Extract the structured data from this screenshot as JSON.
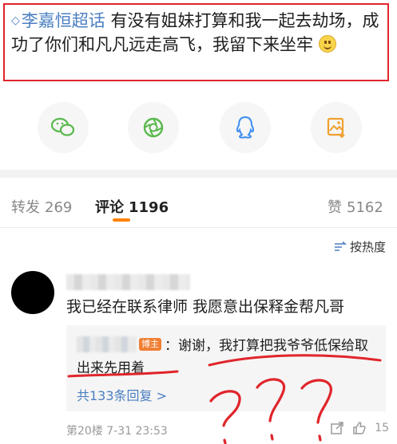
{
  "post": {
    "topic": "李嘉恒超话",
    "text": " 有没有姐妹打算和我一起去劫场，成功了你们和凡凡远走高飞，我留下来坐牢"
  },
  "share_buttons": [
    {
      "icon": "wechat-icon",
      "color": "#58b94b"
    },
    {
      "icon": "moments-icon",
      "color": "#58b94b"
    },
    {
      "icon": "qq-icon",
      "color": "#3d8ef0"
    },
    {
      "icon": "save-image-icon",
      "color": "#f0a030"
    }
  ],
  "tabs": {
    "repost": {
      "label": "转发",
      "count": "269"
    },
    "comments": {
      "label": "评论",
      "count": "1196"
    },
    "likes": {
      "label": "赞",
      "count": "5162"
    }
  },
  "sort": {
    "label": "按热度"
  },
  "comment": {
    "text": "我已经在联系律师 我愿意出保释金帮凡哥",
    "reply": {
      "badge": "博主",
      "text": "：谢谢，我打算把我爷爷低保给取出来先用着"
    },
    "total_replies": "共133条回复 >",
    "meta": "第20楼 7-31 23:53",
    "like_count": "15"
  },
  "colors": {
    "highlight": "#e0252b",
    "accent": "#ff8200",
    "link": "#4a7fc1"
  }
}
